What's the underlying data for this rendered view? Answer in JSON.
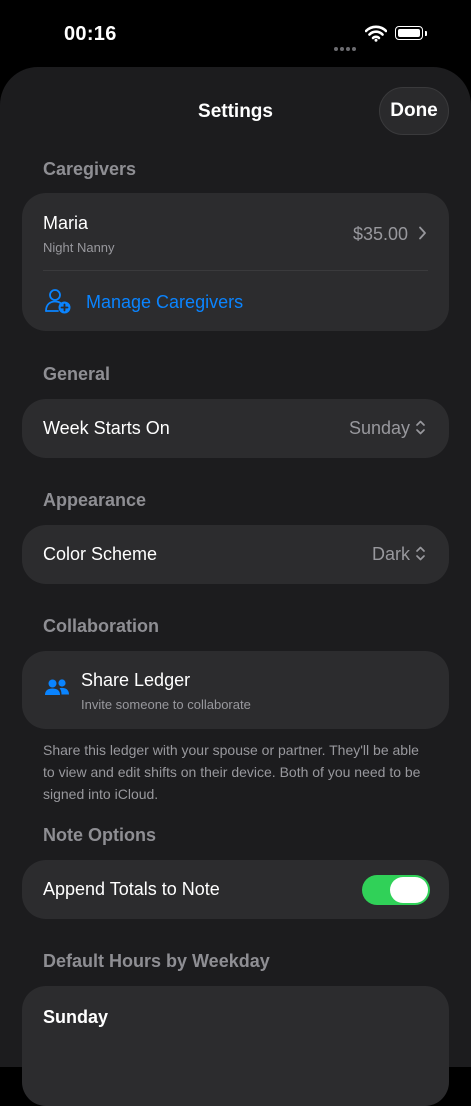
{
  "status_bar": {
    "time": "00:16"
  },
  "nav": {
    "title": "Settings",
    "done_label": "Done"
  },
  "caregivers": {
    "header": "Caregivers",
    "caregiver": {
      "name": "Maria",
      "role": "Night Nanny",
      "rate": "$35.00"
    },
    "manage_label": "Manage Caregivers"
  },
  "general": {
    "header": "General",
    "week_starts_label": "Week Starts On",
    "week_starts_value": "Sunday"
  },
  "appearance": {
    "header": "Appearance",
    "color_scheme_label": "Color Scheme",
    "color_scheme_value": "Dark"
  },
  "collaboration": {
    "header": "Collaboration",
    "share_title": "Share Ledger",
    "share_subtitle": "Invite someone to collaborate",
    "footer": "Share this ledger with your spouse or partner. They'll be able to view and edit shifts on their device. Both of you need to be signed into iCloud."
  },
  "note_options": {
    "header": "Note Options",
    "append_label": "Append Totals to Note",
    "append_on": true
  },
  "default_hours": {
    "header": "Default Hours by Weekday",
    "first_day": "Sunday"
  },
  "colors": {
    "accent": "#0a84ff",
    "toggle_on": "#30d158",
    "sheet_bg": "#1c1c1e",
    "card_bg": "#2c2c2e"
  }
}
